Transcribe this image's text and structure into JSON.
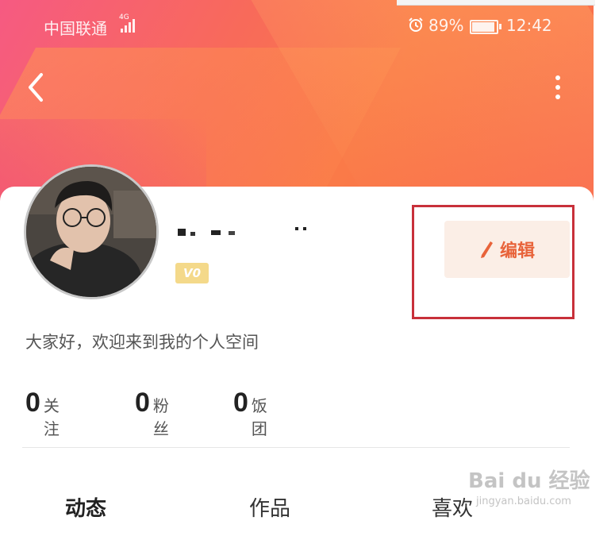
{
  "status_bar": {
    "carrier": "中国联通",
    "network": "4G",
    "battery_percent": "89%",
    "battery_level": 0.89,
    "time": "12:42"
  },
  "nav": {
    "back_icon": "chevron-left-icon",
    "more_icon": "more-vertical-icon"
  },
  "profile": {
    "level_badge": "V0",
    "edit_label": "编辑",
    "bio": "大家好，欢迎来到我的个人空间",
    "stats": [
      {
        "value": "0",
        "label": "关注"
      },
      {
        "value": "0",
        "label": "粉丝"
      },
      {
        "value": "0",
        "label": "饭团"
      }
    ]
  },
  "tabs": [
    {
      "label": "动态",
      "active": true
    },
    {
      "label": "作品",
      "active": false
    },
    {
      "label": "喜欢",
      "active": false
    }
  ],
  "watermark": {
    "text": "Bai du 经验",
    "url": "jingyan.baidu.com"
  },
  "colors": {
    "accent": "#e8633a",
    "edit_bg": "#fbeee6",
    "highlight": "#c8303a",
    "badge": "#f4d98a"
  }
}
